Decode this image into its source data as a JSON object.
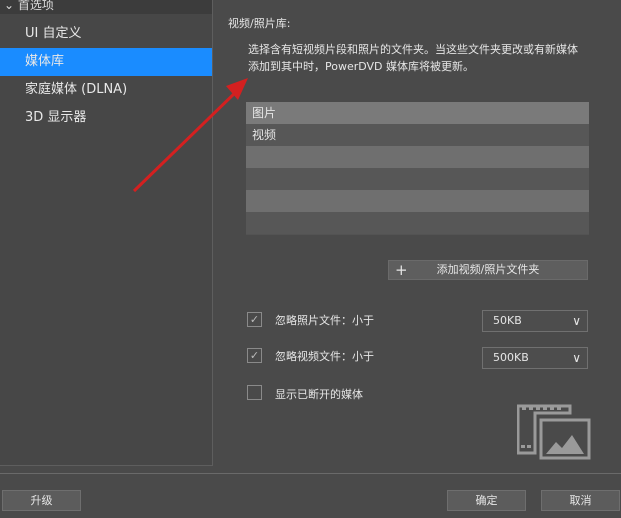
{
  "sidebar": {
    "header": "首选项",
    "items": [
      {
        "label": "UI 自定义"
      },
      {
        "label": "媒体库"
      },
      {
        "label": "家庭媒体 (DLNA)"
      },
      {
        "label": "3D 显示器"
      }
    ]
  },
  "main": {
    "title": "视频/照片库:",
    "description": "选择含有短视频片段和照片的文件夹。当这些文件夹更改或有新媒体添加到其中时，PowerDVD 媒体库将被更新。",
    "folders": [
      "图片",
      "视频"
    ],
    "add_button": "添加视频/照片文件夹",
    "options": [
      {
        "label": "忽略照片文件：小于",
        "checked": true,
        "value": "50KB"
      },
      {
        "label": "忽略视频文件：小于",
        "checked": true,
        "value": "500KB"
      },
      {
        "label": "显示已断开的媒体",
        "checked": false
      }
    ]
  },
  "footer": {
    "upgrade": "升级",
    "ok": "确定",
    "cancel": "取消"
  },
  "colors": {
    "selected": "#1a8cff",
    "annotation_arrow": "#d42020"
  }
}
